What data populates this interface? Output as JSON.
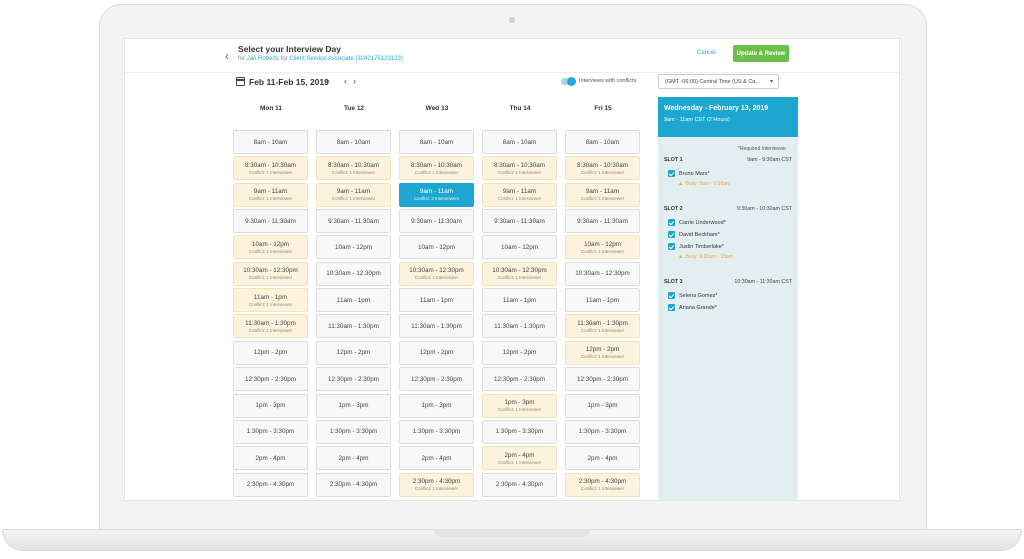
{
  "header": {
    "title": "Select your Interview Day",
    "for_prefix": "for",
    "candidate": "Jan Roberts",
    "for_middle": "for",
    "position": "Client Service Associate (3242175123123)",
    "cancel_label": "Cancel",
    "update_label": "Update & Review"
  },
  "toolbar": {
    "date_range": "Feb 11-Feb 15, 2019",
    "conflicts_label": "Interviews with conflicts",
    "conflicts_on": true,
    "timezone": "(GMT -06:00) Central Time (US & Ca..."
  },
  "days": [
    "Mon 11",
    "Tue 12",
    "Wed 13",
    "Thu 14",
    "Fri 15"
  ],
  "times": [
    "8am - 10am",
    "8:30am - 10:30am",
    "9am - 11am",
    "9:30am - 11:30am",
    "10am - 12pm",
    "10:30am - 12:30pm",
    "11am - 1pm",
    "11:30am - 1:30pm",
    "12pm - 2pm",
    "12:30pm - 2:30pm",
    "1pm - 3pm",
    "1:30pm - 3:30pm",
    "2pm - 4pm",
    "2:30pm - 4:30pm"
  ],
  "conflict_texts": {
    "one": "Conflict: 1 Interviewer",
    "two": "Conflict: 2 Interviewers"
  },
  "grid": [
    [
      "",
      "",
      "",
      "",
      "",
      "",
      "",
      "",
      "",
      "",
      "",
      "",
      "",
      ""
    ],
    [
      "",
      "",
      "",
      "",
      "",
      "",
      "",
      "",
      "",
      "",
      "",
      "",
      "",
      ""
    ],
    [
      "",
      "",
      "",
      "",
      "",
      "",
      "",
      "",
      "",
      "",
      "",
      "",
      "",
      ""
    ],
    [
      "",
      "",
      "",
      "",
      "",
      "",
      "",
      "",
      "",
      "",
      "",
      "",
      "",
      ""
    ],
    [
      "",
      "",
      "",
      "",
      "",
      "",
      "",
      "",
      "",
      "",
      "",
      "",
      "",
      ""
    ]
  ],
  "conflicts": [
    [
      0,
      1,
      1,
      0,
      1,
      1,
      1,
      1,
      0,
      0,
      0,
      0,
      0,
      0
    ],
    [
      0,
      1,
      1,
      0,
      0,
      0,
      0,
      0,
      0,
      0,
      0,
      0,
      0,
      0
    ],
    [
      0,
      1,
      2,
      0,
      0,
      1,
      0,
      0,
      0,
      0,
      0,
      0,
      0,
      1
    ],
    [
      0,
      1,
      1,
      0,
      0,
      1,
      0,
      0,
      0,
      0,
      1,
      0,
      1,
      0
    ],
    [
      0,
      1,
      1,
      0,
      1,
      0,
      0,
      1,
      1,
      0,
      0,
      0,
      0,
      1
    ]
  ],
  "selected": {
    "day": 2,
    "slot": 2
  },
  "panel": {
    "day_title": "Wednesday - February 13, 2019",
    "time_range": "9am - 11am CST (2 Hours)",
    "required_note": "*Required Interviewer",
    "slots": [
      {
        "label": "SLOT 1",
        "time": "9am - 9:30am CST",
        "people": [
          "Bruno Mars*"
        ],
        "busy": [
          "Busy: 9am - 9:30am"
        ]
      },
      {
        "label": "SLOT 2",
        "time": "9:30am - 10:30am CST",
        "people": [
          "Carrie Underwood*",
          "David Beckham*",
          "Justin Timberlake*"
        ],
        "busy": [
          "Busy: 9:30am - 10am"
        ]
      },
      {
        "label": "SLOT 3",
        "time": "10:30am - 11:30am CST",
        "people": [
          "Selena Gomez*",
          "Ariana Grande*"
        ],
        "busy": []
      }
    ]
  },
  "colors": {
    "accent": "#1da6cf",
    "confirm": "#6cc04a",
    "conflict_bg": "#fdf3dc",
    "busy": "#f0a531"
  }
}
